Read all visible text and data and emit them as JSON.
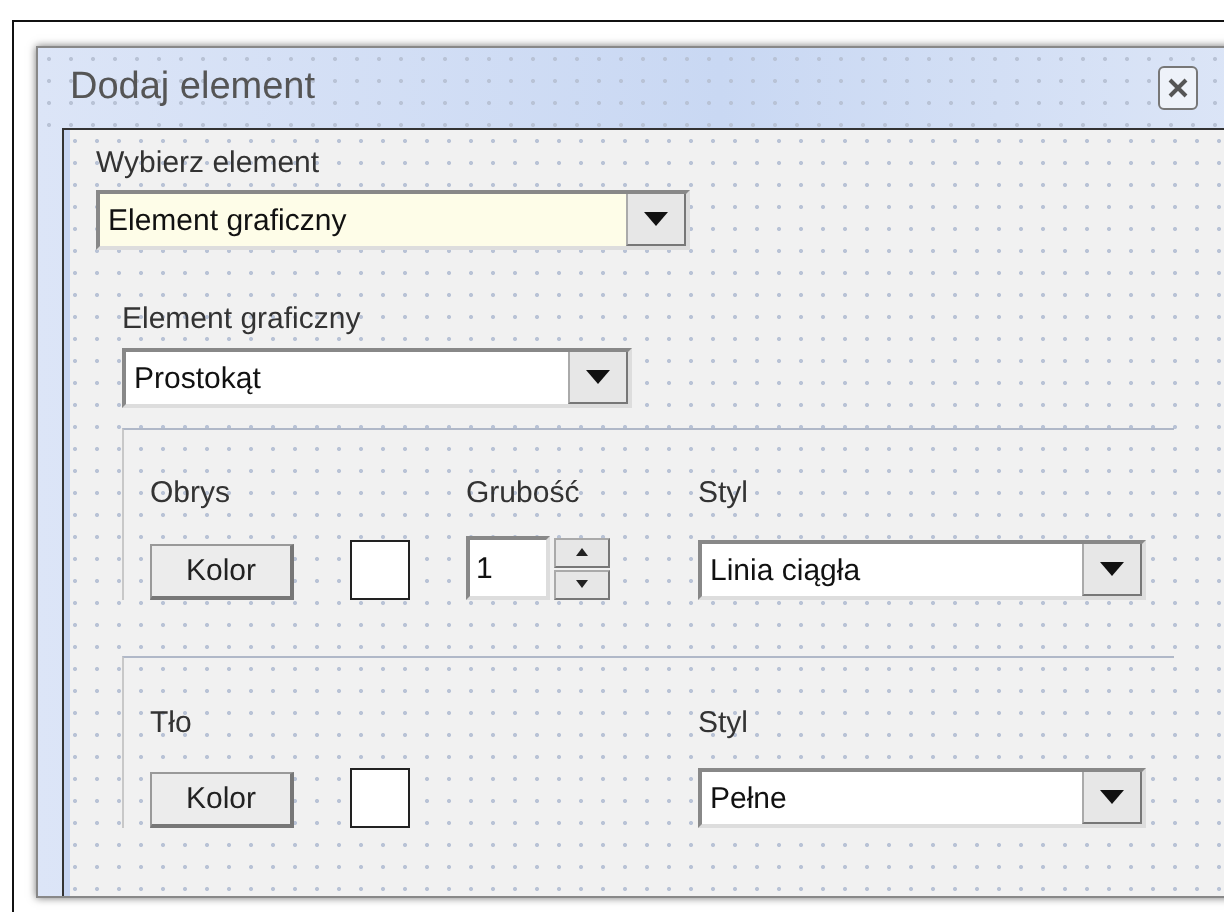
{
  "window": {
    "title": "Dodaj element"
  },
  "element_select": {
    "label": "Wybierz element",
    "value": "Element graficzny"
  },
  "graphic_select": {
    "label": "Element graficzny",
    "value": "Prostokąt"
  },
  "outline": {
    "label": "Obrys",
    "color_button": "Kolor",
    "thickness": {
      "label": "Grubość",
      "value": "1"
    },
    "style": {
      "label": "Styl",
      "value": "Linia ciągła"
    }
  },
  "fill": {
    "label": "Tło",
    "color_button": "Kolor",
    "style": {
      "label": "Styl",
      "value": "Pełne"
    }
  }
}
